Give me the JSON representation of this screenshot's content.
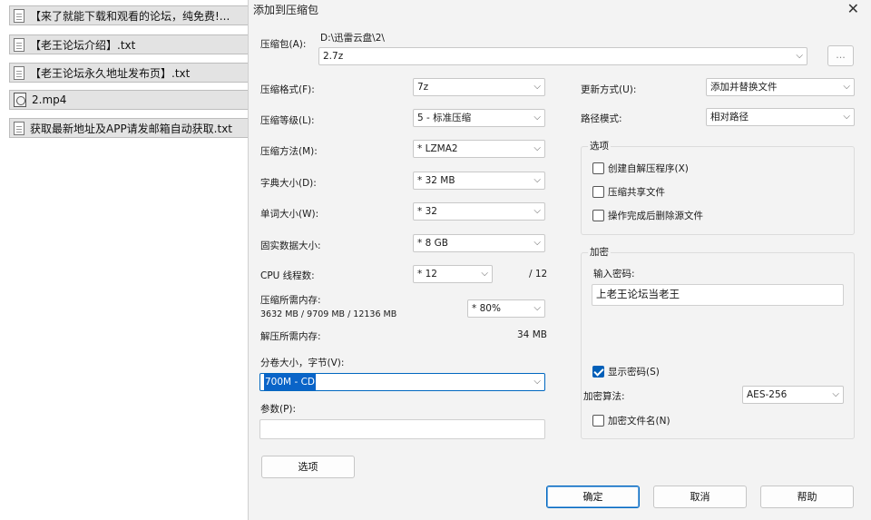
{
  "files": [
    {
      "name": "【来了就能下载和观看的论坛，纯免费!...",
      "icon": "text-file-icon"
    },
    {
      "name": "【老王论坛介绍】.txt",
      "icon": "text-file-icon"
    },
    {
      "name": "【老王论坛永久地址发布页】.txt",
      "icon": "text-file-icon"
    },
    {
      "name": "2.mp4",
      "icon": "video-file-icon"
    },
    {
      "name": "获取最新地址及APP请发邮箱自动获取.txt",
      "icon": "text-file-icon"
    }
  ],
  "dialog": {
    "title": "添加到压缩包",
    "close": "✕",
    "archive_label": "压缩包(A):",
    "archive_path": "D:\\迅雷云盘\\2\\",
    "archive_name": "2.7z",
    "browse_label": "...",
    "format_label": "压缩格式(F):",
    "format_value": "7z",
    "level_label": "压缩等级(L):",
    "level_value": "5 - 标准压缩",
    "method_label": "压缩方法(M):",
    "method_value": "* LZMA2",
    "dict_label": "字典大小(D):",
    "dict_value": "* 32 MB",
    "word_label": "单词大小(W):",
    "word_value": "* 32",
    "solid_label": "固实数据大小:",
    "solid_value": "* 8 GB",
    "cpu_label": "CPU 线程数:",
    "cpu_value": "* 12",
    "cpu_total": "/ 12",
    "mem_label": "压缩所需内存:",
    "mem_detail": "3632 MB / 9709 MB / 12136 MB",
    "mem_value": "* 80%",
    "decomp_label": "解压所需内存:",
    "decomp_value": "34 MB",
    "split_label": "分卷大小，字节(V):",
    "split_value": "700M - CD",
    "params_label": "参数(P):",
    "params_value": "",
    "options_button": "选项",
    "update_label": "更新方式(U):",
    "update_value": "添加并替换文件",
    "path_label": "路径模式:",
    "path_value": "相对路径",
    "options_group": "选项",
    "opt_sfx": "创建自解压程序(X)",
    "opt_shared": "压缩共享文件",
    "opt_delete": "操作完成后删除源文件",
    "encrypt_group": "加密",
    "password_label": "输入密码:",
    "password_value": "上老王论坛当老王",
    "show_password": "显示密码(S)",
    "method_enc_label": "加密算法:",
    "method_enc_value": "AES-256",
    "encrypt_names": "加密文件名(N)",
    "ok": "确定",
    "cancel": "取消",
    "help": "帮助"
  },
  "colors": {
    "accent": "#005fb8",
    "selection": "#0a64c8",
    "dialog_bg": "#f3f3f3",
    "file_bg": "#e3e3e3"
  }
}
